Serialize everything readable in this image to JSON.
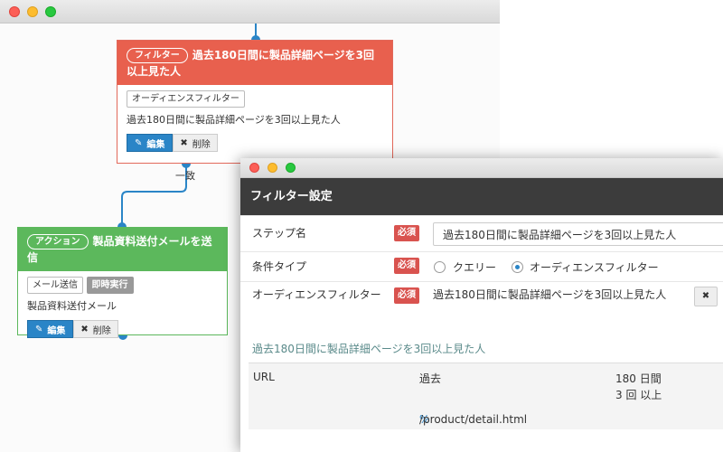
{
  "back_window": {
    "filter_node": {
      "badge": "フィルター",
      "title": "過去180日間に製品詳細ページを3回以上見た人",
      "tag": "オーディエンスフィルター",
      "description": "過去180日間に製品詳細ページを3回以上見た人",
      "edit_label": "編集",
      "delete_label": "削除",
      "accent": "#e8604e"
    },
    "match_label": "一致",
    "action_node": {
      "badge": "アクション",
      "title": "製品資料送付メールを送信",
      "tag": "メール送信",
      "tag2": "即時実行",
      "description": "製品資料送付メール",
      "edit_label": "編集",
      "delete_label": "削除",
      "accent": "#5cb85c"
    },
    "connector_color": "#2a85c7"
  },
  "front_window": {
    "header_title": "フィルター設定",
    "required_label": "必須",
    "step_name": {
      "label": "ステップ名",
      "value": "過去180日間に製品詳細ページを3回以上見た人"
    },
    "condition_type": {
      "label": "条件タイプ",
      "options": [
        "クエリー",
        "オーディエンスフィルター"
      ],
      "selected": "オーディエンスフィルター"
    },
    "audience_filter": {
      "label": "オーディエンスフィルター",
      "value": "過去180日間に製品詳細ページを3回以上見た人"
    },
    "audience_title": "過去180日間に製品詳細ページを3回以上見た人",
    "detail": {
      "col1": "URL",
      "col2": "過去",
      "period": "180 日間",
      "count": "3 回 以上",
      "url_pattern": "/product/detail.html",
      "url_suffix": "%"
    }
  }
}
